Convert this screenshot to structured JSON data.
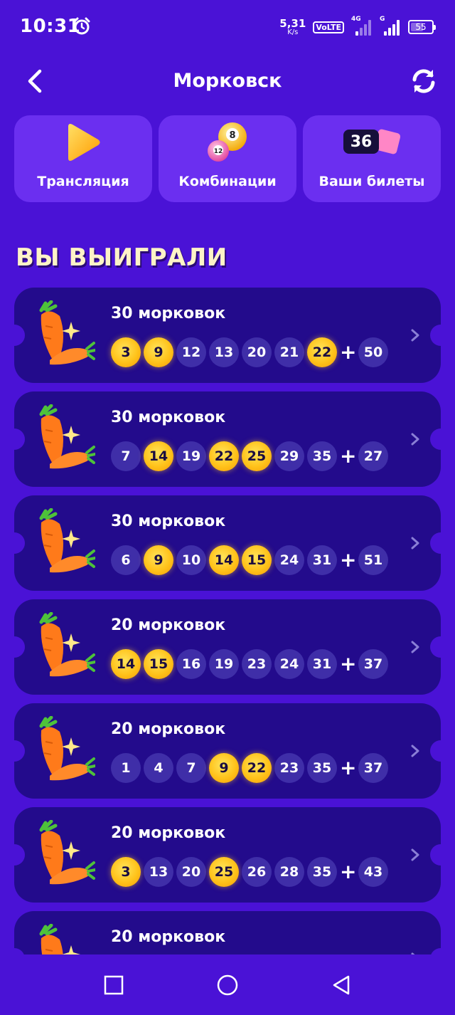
{
  "status_bar": {
    "time": "10:31",
    "speed_value": "5,31",
    "speed_unit": "K/s",
    "volte": "VoLTE",
    "network_4g": "4G",
    "network_g": "G",
    "battery": "55"
  },
  "header": {
    "title": "Морковск"
  },
  "tiles": [
    {
      "label": "Трансляция",
      "icon": "play-icon"
    },
    {
      "label": "Комбинации",
      "icon": "lottery-balls-icon"
    },
    {
      "label": "Ваши билеты",
      "icon": "tickets-icon",
      "count": "36"
    }
  ],
  "section_heading": "ВЫ ВЫИГРАЛИ",
  "tickets": [
    {
      "prize": "30 морковок",
      "numbers": [
        "3",
        "9",
        "12",
        "13",
        "20",
        "21",
        "22"
      ],
      "highlighted": [
        "3",
        "9",
        "22"
      ],
      "bonus": "50"
    },
    {
      "prize": "30 морковок",
      "numbers": [
        "7",
        "14",
        "19",
        "22",
        "25",
        "29",
        "35"
      ],
      "highlighted": [
        "14",
        "22",
        "25"
      ],
      "bonus": "27"
    },
    {
      "prize": "30 морковок",
      "numbers": [
        "6",
        "9",
        "10",
        "14",
        "15",
        "24",
        "31"
      ],
      "highlighted": [
        "9",
        "14",
        "15"
      ],
      "bonus": "51"
    },
    {
      "prize": "20 морковок",
      "numbers": [
        "14",
        "15",
        "16",
        "19",
        "23",
        "24",
        "31"
      ],
      "highlighted": [
        "14",
        "15"
      ],
      "bonus": "37"
    },
    {
      "prize": "20 морковок",
      "numbers": [
        "1",
        "4",
        "7",
        "9",
        "22",
        "23",
        "35"
      ],
      "highlighted": [
        "9",
        "22"
      ],
      "bonus": "37"
    },
    {
      "prize": "20 морковок",
      "numbers": [
        "3",
        "13",
        "20",
        "25",
        "26",
        "28",
        "35"
      ],
      "highlighted": [
        "3",
        "25"
      ],
      "bonus": "43"
    },
    {
      "prize": "20 морковок",
      "numbers": [],
      "highlighted": [],
      "bonus": ""
    }
  ],
  "plus_sign": "+",
  "colors": {
    "background": "#4a12d6",
    "tile": "#6b2ff0",
    "ticket": "#230b8c",
    "ball": "#3f2ea8",
    "ball_win": "#ffc21a",
    "heading": "#fdf3c7"
  }
}
